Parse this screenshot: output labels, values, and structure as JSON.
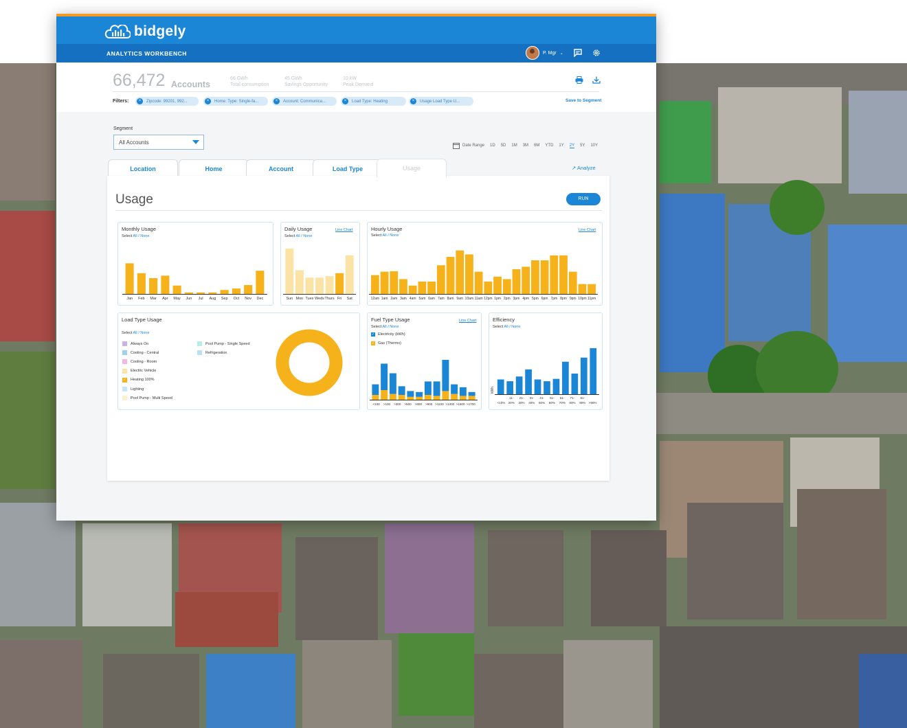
{
  "brand": {
    "name": "bidgely",
    "section": "ANALYTICS WORKBENCH"
  },
  "user": {
    "name": "P. Mgr"
  },
  "header": {
    "accounts_count": "66,472",
    "accounts_label": "Accounts",
    "stats": [
      {
        "value": "66 GWh",
        "label": "Total consumption"
      },
      {
        "value": "45 GWh",
        "label": "Savings Opportunity"
      },
      {
        "value": "10 kW",
        "label": "Peak Demand"
      }
    ]
  },
  "filters": {
    "label": "Filters:",
    "chips": [
      "Zipcode: 99201, 992...",
      "Home: Type: Single-fa...",
      "Account: Communica...",
      "Load Type: Heating",
      "Usage Load Type U..."
    ],
    "save_label": "Save to Segment"
  },
  "segment": {
    "label": "Segment",
    "value": "All Accounts"
  },
  "date_range": {
    "label": "Date Range",
    "options": [
      "1D",
      "5D",
      "1M",
      "3M",
      "6M",
      "YTD",
      "1Y",
      "2Y",
      "5Y",
      "10Y"
    ],
    "selected": "2Y"
  },
  "tabs": [
    "Location",
    "Home",
    "Account",
    "Load Type",
    "Usage"
  ],
  "active_tab": "Usage",
  "analyze_label": "Analyze",
  "panel": {
    "title": "Usage",
    "run_label": "RUN"
  },
  "common": {
    "select": "Select",
    "all": "All",
    "none": "None",
    "sep": "/",
    "line_chart": "Line Chart"
  },
  "colors": {
    "accent": "#1b85d6",
    "bar": "#f6b21b",
    "bar_light": "#fbe3a6",
    "electric": "#1b85d6",
    "top_orange": "#f39a22"
  },
  "chart_data": [
    {
      "id": "monthly",
      "type": "bar",
      "title": "Monthly Usage",
      "categories": [
        "Jan",
        "Feb",
        "Mar",
        "Apr",
        "May",
        "Jun",
        "Jul",
        "Aug",
        "Sep",
        "Oct",
        "Nov",
        "Dec"
      ],
      "values": [
        62,
        42,
        32,
        37,
        17,
        3,
        3,
        3,
        8,
        11,
        18,
        47
      ],
      "ylim": [
        0,
        100
      ]
    },
    {
      "id": "daily",
      "type": "bar",
      "title": "Daily Usage",
      "categories": [
        "Sun",
        "Mon",
        "Tues",
        "Weds",
        "Thurs",
        "Fri",
        "Sat"
      ],
      "values": [
        92,
        48,
        33,
        33,
        36,
        42,
        78
      ],
      "highlighted": [
        false,
        false,
        false,
        false,
        false,
        true,
        false
      ],
      "ylim": [
        0,
        100
      ]
    },
    {
      "id": "hourly",
      "type": "bar",
      "title": "Hourly Usage",
      "categories": [
        "12am",
        "1am",
        "2am",
        "3am",
        "4am",
        "5am",
        "6am",
        "7am",
        "8am",
        "9am",
        "10am",
        "11am",
        "12pm",
        "1pm",
        "2pm",
        "3pm",
        "4pm",
        "5pm",
        "6pm",
        "7pm",
        "8pm",
        "9pm",
        "10pm",
        "11pm"
      ],
      "values": [
        38,
        45,
        46,
        30,
        17,
        25,
        25,
        58,
        75,
        88,
        80,
        45,
        25,
        35,
        30,
        50,
        55,
        68,
        68,
        78,
        78,
        45,
        20,
        20
      ],
      "ylim": [
        0,
        100
      ]
    },
    {
      "id": "load_type",
      "type": "pie",
      "title": "Load Type Usage",
      "legend": [
        "Always On",
        "Cooling - Central",
        "Cooling - Room",
        "Electric Vehicle",
        "Heating 100%",
        "Lighting",
        "Pool Pump - Multi Speed",
        "Pool Pump - Single Speed",
        "Refrigeration"
      ],
      "legend_colors": [
        "#c9b3e0",
        "#9fd0ee",
        "#f0b8e2",
        "#fbe3a6",
        "#f6b21b",
        "#c8e6f7",
        "#fdf0d0",
        "#b5eee3",
        "#b9dff3"
      ],
      "checked": [
        false,
        false,
        false,
        false,
        true,
        false,
        false,
        false,
        false
      ],
      "values": [
        0,
        0,
        0,
        0,
        100,
        0,
        0,
        0,
        0
      ]
    },
    {
      "id": "fuel",
      "type": "bar",
      "title": "Fuel Type Usage",
      "series": [
        {
          "name": "Electricity (kWh)",
          "values": [
            22,
            55,
            43,
            18,
            12,
            10,
            28,
            30,
            65,
            20,
            18,
            8
          ]
        },
        {
          "name": "Gas (Therms)",
          "values": [
            10,
            20,
            12,
            10,
            6,
            6,
            10,
            8,
            18,
            12,
            8,
            8
          ]
        }
      ],
      "categories": [
        "<100",
        ">100",
        ">300",
        ">500",
        ">800",
        ">900",
        ">1100",
        ">1300",
        ">1500",
        ">1700"
      ],
      "ylim": [
        0,
        100
      ]
    },
    {
      "id": "efficiency",
      "type": "bar",
      "title": "Efficiency",
      "ylabel": "kWh",
      "categories": [
        "<10%",
        "11-20%",
        "21-30%",
        "31-40%",
        "41-50%",
        "51-60%",
        "61-70%",
        "71-80%",
        "81-90%",
        ">90%"
      ],
      "values": [
        25,
        22,
        30,
        42,
        25,
        22,
        26,
        55,
        35,
        62,
        78
      ],
      "ylim": [
        0,
        100
      ]
    }
  ]
}
